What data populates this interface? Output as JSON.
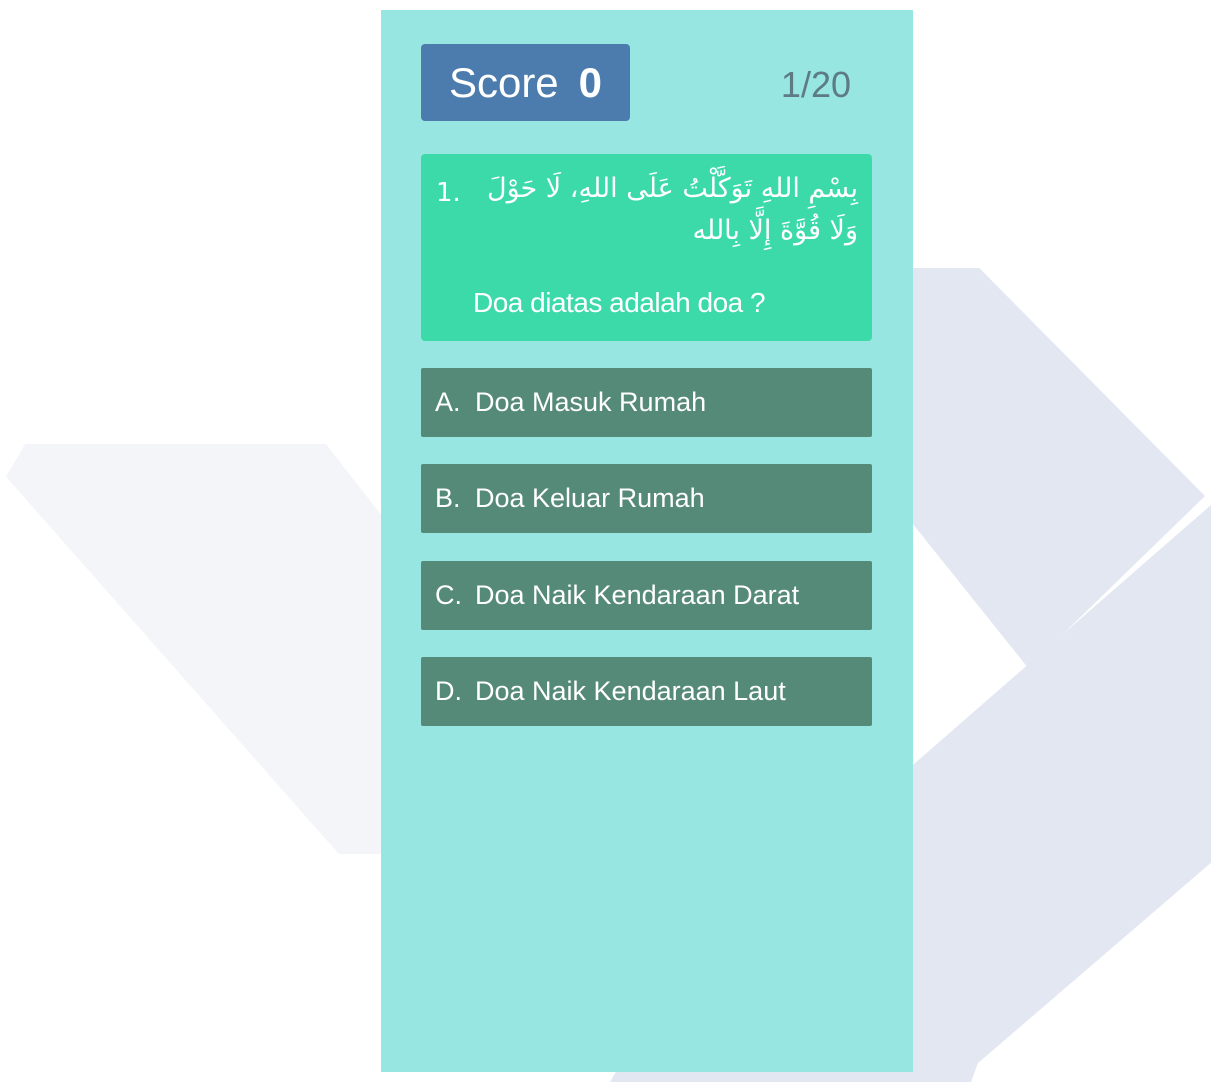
{
  "header": {
    "score_label": "Score",
    "score_value": "0",
    "progress": "1/20"
  },
  "question": {
    "number": "1.",
    "arabic_text": "بِسْمِ اللهِ تَوَكَّلْتُ عَلَى اللهِ، لَا حَوْلَ وَلَا قُوَّةَ إِلَّا بِالله",
    "prompt": "Doa diatas adalah doa ?"
  },
  "answers": [
    {
      "letter": "A.",
      "text": "Doa Masuk Rumah"
    },
    {
      "letter": "B.",
      "text": "Doa Keluar Rumah"
    },
    {
      "letter": "C.",
      "text": "Doa Naik Kendaraan Darat"
    },
    {
      "letter": "D.",
      "text": "Doa Naik Kendaraan Laut"
    }
  ],
  "colors": {
    "screen_bg": "#97e6e1",
    "score_bg": "#4c7cad",
    "question_bg": "#3cdaa8",
    "answer_bg": "#558a79",
    "progress_text": "#5d7b83"
  }
}
